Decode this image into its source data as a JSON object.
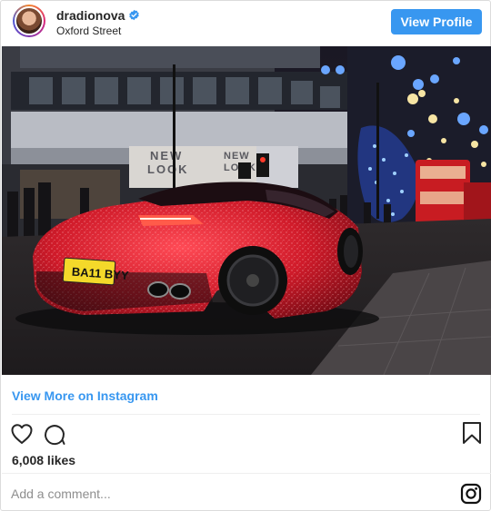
{
  "header": {
    "username": "dradionova",
    "location": "Oxford Street",
    "view_profile_label": "View Profile",
    "verified_icon": "verified-badge-icon"
  },
  "photo": {
    "plate_text": "BA11 BYY",
    "store_sign_1": "NEW",
    "store_sign_2": "LOOK",
    "store_sign_3": "NEW",
    "store_sign_4": "LOOK"
  },
  "links": {
    "view_more_label": "View More on Instagram"
  },
  "actions": {
    "like_icon": "heart-icon",
    "comment_icon": "comment-icon",
    "save_icon": "bookmark-icon"
  },
  "likes_text": "6,008 likes",
  "comment": {
    "placeholder": "Add a comment...",
    "logo_icon": "instagram-logo-icon"
  },
  "colors": {
    "accent": "#3897f0",
    "text": "#262626",
    "muted": "#8e8e8e",
    "border": "#dbdbdb"
  }
}
